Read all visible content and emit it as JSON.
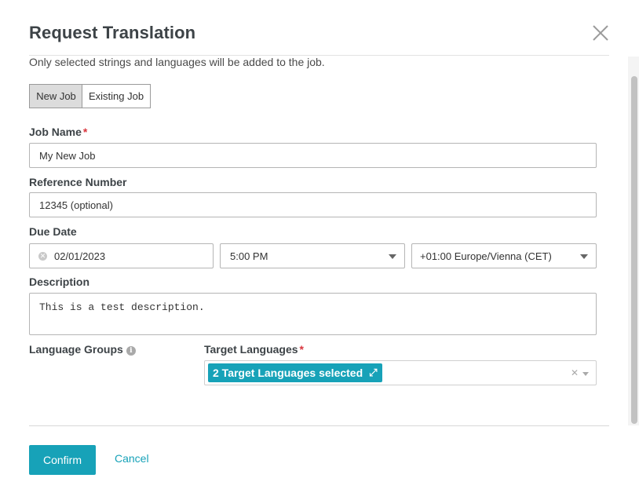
{
  "modal": {
    "title": "Request Translation",
    "subtitle": "Only selected strings and languages will be added to the job."
  },
  "job_type": {
    "options": [
      "New Job",
      "Existing Job"
    ],
    "selected": "New Job"
  },
  "form": {
    "job_name": {
      "label": "Job Name",
      "required_mark": "*",
      "value": "My New Job"
    },
    "reference_number": {
      "label": "Reference Number",
      "value": "12345 (optional)"
    },
    "due_date": {
      "label": "Due Date",
      "date": "02/01/2023",
      "time": "5:00 PM",
      "timezone": "+01:00 Europe/Vienna (CET)"
    },
    "description": {
      "label": "Description",
      "value": "This is a test description."
    },
    "language_groups": {
      "label": "Language Groups"
    },
    "target_languages": {
      "label": "Target Languages",
      "required_mark": "*",
      "tag": "2 Target Languages selected"
    }
  },
  "footer": {
    "confirm_label": "Confirm",
    "cancel_label": "Cancel"
  },
  "colors": {
    "accent": "#17a2b8",
    "required": "#d9363e"
  },
  "icons": {
    "close": "close-icon",
    "clear": "clear-icon",
    "info": "info-icon",
    "expand": "expand-icon",
    "caret": "chevron-down-icon"
  }
}
